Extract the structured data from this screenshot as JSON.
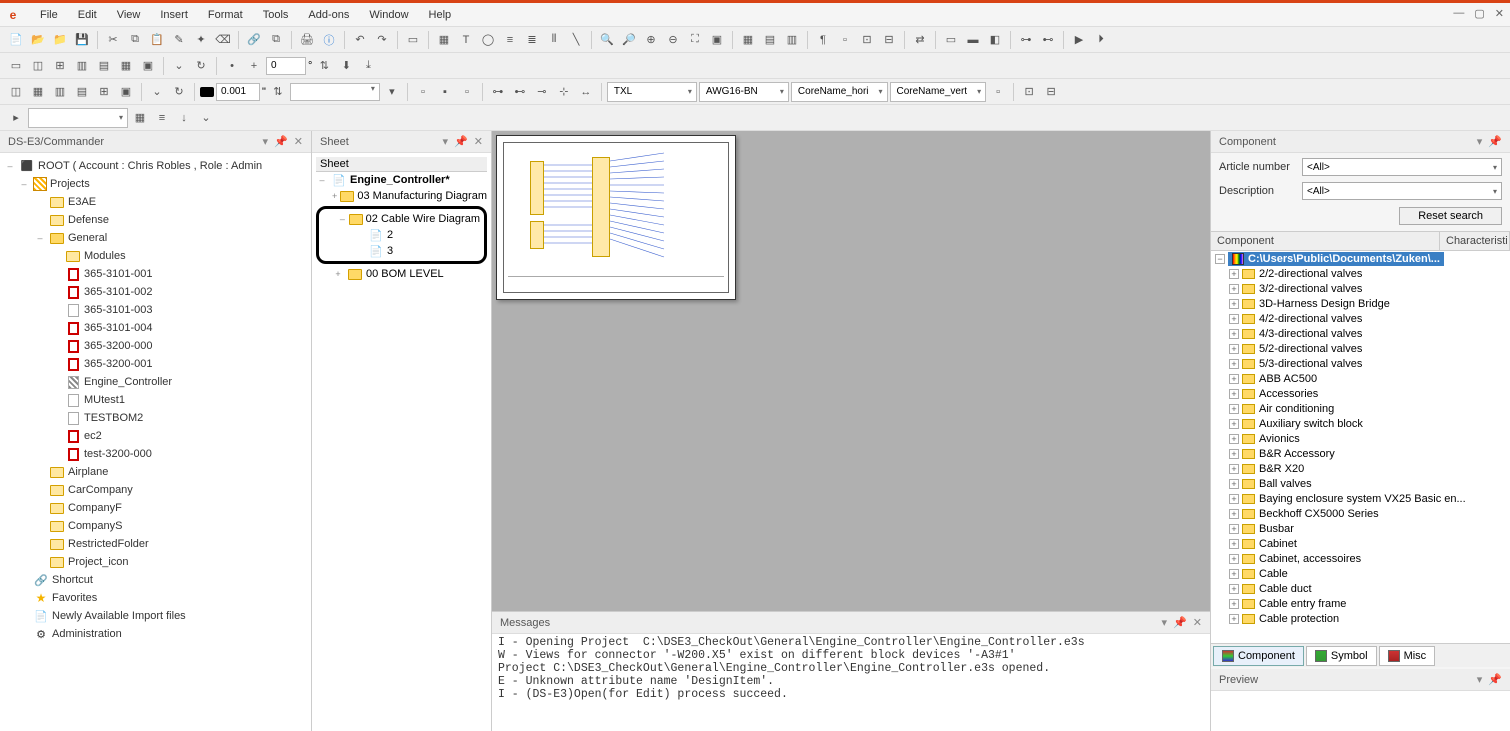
{
  "menu": [
    "File",
    "Edit",
    "View",
    "Insert",
    "Format",
    "Tools",
    "Add-ons",
    "Window",
    "Help"
  ],
  "toolbar3": {
    "angle": "0",
    "angle_unit": "°"
  },
  "toolbar4": {
    "value": "0.001",
    "unit": "\"",
    "combo1": "TXL",
    "combo2": "AWG16-BN",
    "combo3": "CoreName_hori",
    "combo4": "CoreName_vert"
  },
  "commander": {
    "title": "DS-E3/Commander",
    "root": "ROOT ( Account : Chris Robles , Role : Admin",
    "projects_label": "Projects",
    "items_l1": [
      "E3AE",
      "Defense"
    ],
    "general_label": "General",
    "modules_label": "Modules",
    "docs": [
      "365-3101-001",
      "365-3101-002",
      "365-3101-003",
      "365-3101-004",
      "365-3200-000",
      "365-3200-001"
    ],
    "engine_label": "Engine_Controller",
    "after_engine": [
      "MUtest1",
      "TESTBOM2",
      "ec2",
      "test-3200-000"
    ],
    "more_folders": [
      "Airplane",
      "CarCompany",
      "CompanyF",
      "CompanyS",
      "RestrictedFolder",
      "Project_icon"
    ],
    "bottom": [
      "Shortcut",
      "Favorites",
      "Newly Available Import files",
      "Administration"
    ]
  },
  "sheet": {
    "title": "Sheet",
    "header": "Sheet",
    "root": "Engine_Controller*",
    "items": [
      {
        "label": "03 Manufacturing Diagram"
      },
      {
        "label": "02 Cable Wire Diagram",
        "children": [
          "2",
          "3"
        ],
        "highlight": true
      },
      {
        "label": "00 BOM LEVEL"
      }
    ]
  },
  "messages": {
    "title": "Messages",
    "lines": [
      "I - Opening Project  C:\\DSE3_CheckOut\\General\\Engine_Controller\\Engine_Controller.e3s",
      "W - Views for connector '-W200.X5' exist on different block devices '-A3#1'",
      "Project C:\\DSE3_CheckOut\\General\\Engine_Controller\\Engine_Controller.e3s opened.",
      "E - Unknown attribute name 'DesignItem'.",
      "I - (DS-E3)Open(for Edit) process succeed."
    ]
  },
  "component": {
    "title": "Component",
    "article_label": "Article number",
    "desc_label": "Description",
    "all_value": "<All>",
    "reset": "Reset search",
    "col1": "Component",
    "col2": "Characteristi",
    "root_path": "C:\\Users\\Public\\Documents\\Zuken\\...",
    "folders": [
      "2/2-directional valves",
      "3/2-directional valves",
      "3D-Harness Design Bridge",
      "4/2-directional valves",
      "4/3-directional valves",
      "5/2-directional valves",
      "5/3-directional valves",
      "ABB AC500",
      "Accessories",
      "Air conditioning",
      "Auxiliary switch block",
      "Avionics",
      "B&R Accessory",
      "B&R X20",
      "Ball valves",
      "Baying enclosure system VX25 Basic en...",
      "Beckhoff CX5000 Series",
      "Busbar",
      "Cabinet",
      "Cabinet, accessoires",
      "Cable",
      "Cable duct",
      "Cable entry frame",
      "Cable protection"
    ],
    "tabs": [
      "Component",
      "Symbol",
      "Misc"
    ]
  },
  "preview": {
    "title": "Preview"
  }
}
